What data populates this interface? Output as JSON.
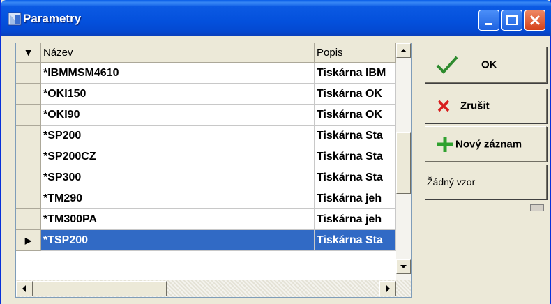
{
  "window": {
    "title": "Parametry"
  },
  "grid": {
    "indicator_header": "▼",
    "columns": [
      "Název",
      "Popis"
    ],
    "rows": [
      {
        "nazev": "*IBMMSM4610",
        "popis": "Tiskárna IBM",
        "selected": false
      },
      {
        "nazev": "*OKI150",
        "popis": "Tiskárna OK",
        "selected": false
      },
      {
        "nazev": "*OKI90",
        "popis": "Tiskárna OK",
        "selected": false
      },
      {
        "nazev": "*SP200",
        "popis": "Tiskárna Sta",
        "selected": false
      },
      {
        "nazev": "*SP200CZ",
        "popis": "Tiskárna Sta",
        "selected": false
      },
      {
        "nazev": "*SP300",
        "popis": "Tiskárna Sta",
        "selected": false
      },
      {
        "nazev": "*TM290",
        "popis": "Tiskárna jeh",
        "selected": false
      },
      {
        "nazev": "*TM300PA",
        "popis": "Tiskárna jeh",
        "selected": false
      },
      {
        "nazev": "*TSP200",
        "popis": "Tiskárna Sta",
        "selected": true
      }
    ],
    "current_row_marker": "▶"
  },
  "buttons": {
    "ok": "OK",
    "cancel": "Zrušit",
    "new_record": "Nový záznam",
    "pattern": "Žádný vzor"
  },
  "colors": {
    "selection": "#316ac5",
    "ok_icon": "#2e8b2e",
    "cancel_icon": "#d81e1e",
    "add_icon": "#2fa12f"
  },
  "icons": {
    "app": "app-icon",
    "ok": "checkmark-icon",
    "cancel": "x-icon",
    "new": "plus-icon"
  }
}
